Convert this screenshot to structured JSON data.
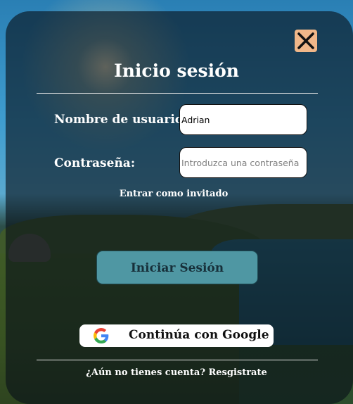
{
  "dialog": {
    "title": "Inicio sesión",
    "close_icon": "close-icon"
  },
  "form": {
    "username_label": "Nombre de usuario:",
    "username_value": "Adrian",
    "password_label": "Contraseña:",
    "password_placeholder": "Introduzca una contraseña",
    "guest_link": "Entrar como invitado",
    "submit_label": "Iniciar Sesión"
  },
  "oauth": {
    "google_label": "Continúa con Google",
    "google_icon": "google-icon"
  },
  "footer": {
    "register_text": "¿Aún no tienes cuenta? Resgistrate"
  },
  "colors": {
    "close_bg": "#f0b789",
    "submit_bg": "#4f97a3",
    "overlay": "rgba(8,16,24,0.62)"
  }
}
